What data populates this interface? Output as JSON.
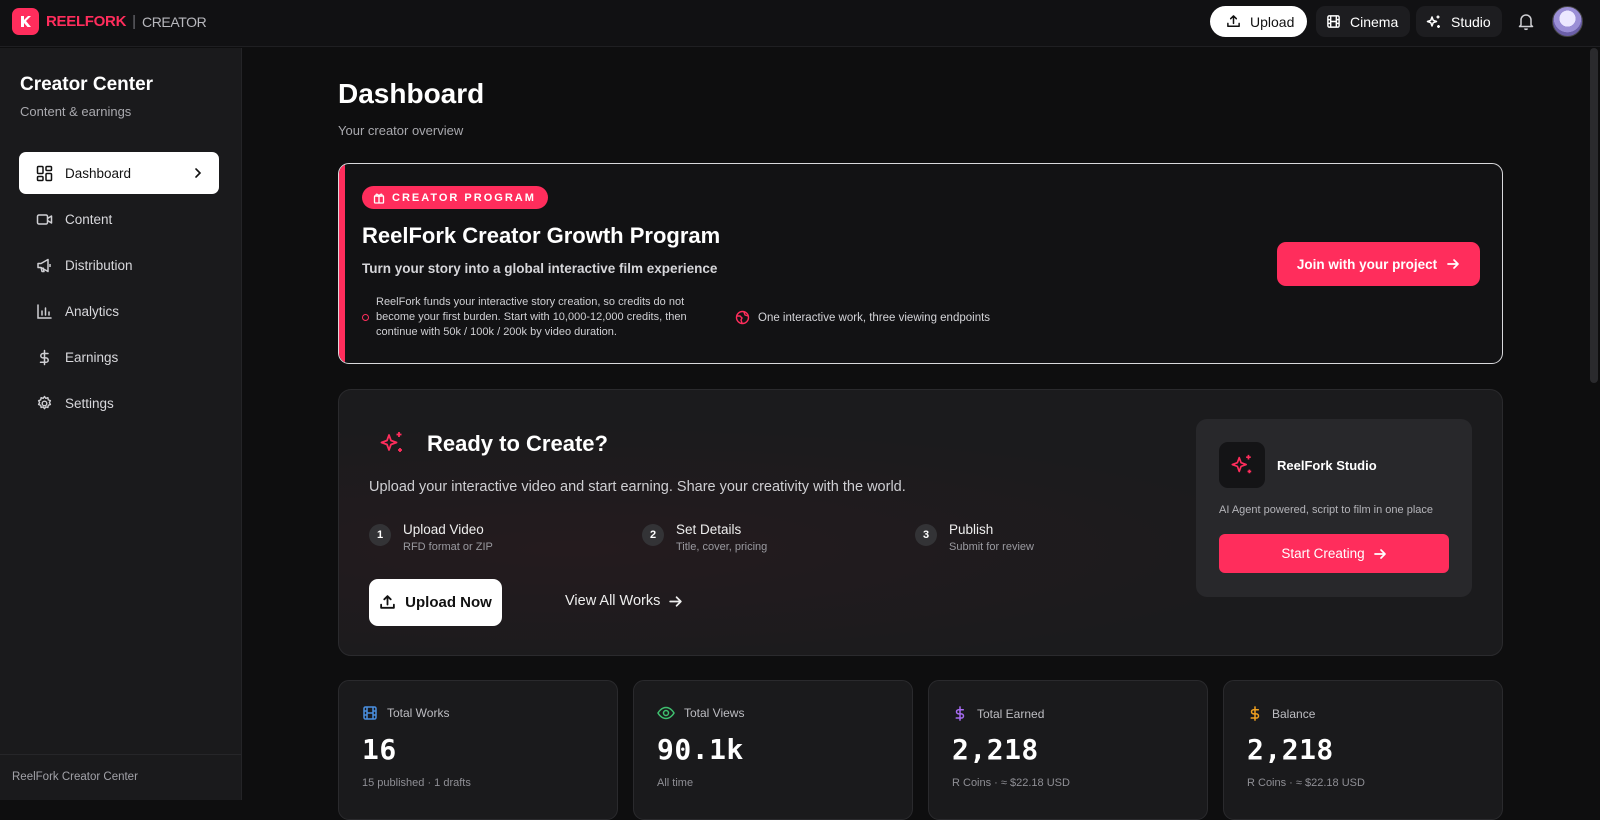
{
  "brand": {
    "name": "REELFORK",
    "separator": "|",
    "section": "CREATOR",
    "accent": "#ff2d5c"
  },
  "topnav": {
    "upload": "Upload",
    "cinema": "Cinema",
    "studio": "Studio"
  },
  "sidebar": {
    "title": "Creator Center",
    "subtitle": "Content & earnings",
    "items": [
      {
        "label": "Dashboard",
        "icon": "dashboard-icon",
        "active": true
      },
      {
        "label": "Content",
        "icon": "video-camera-icon"
      },
      {
        "label": "Distribution",
        "icon": "megaphone-icon"
      },
      {
        "label": "Analytics",
        "icon": "bar-chart-icon"
      },
      {
        "label": "Earnings",
        "icon": "dollar-icon"
      },
      {
        "label": "Settings",
        "icon": "gear-icon"
      }
    ],
    "footer": "ReelFork Creator Center"
  },
  "page": {
    "title": "Dashboard",
    "subtitle": "Your creator overview"
  },
  "promo": {
    "badge": "CREATOR PROGRAM",
    "title": "ReelFork Creator Growth Program",
    "subtitle": "Turn your story into a global interactive film experience",
    "bullet1": "ReelFork funds your interactive story creation, so credits do not become your first burden. Start with 10,000-12,000 credits, then continue with 50k / 100k / 200k by video duration.",
    "bullet2": "One interactive work, three viewing endpoints",
    "cta": "Join with your project"
  },
  "ready": {
    "title": "Ready to Create?",
    "description": "Upload your interactive video and start earning. Share your creativity with the world.",
    "steps": [
      {
        "num": "1",
        "title": "Upload Video",
        "sub": "RFD format or ZIP"
      },
      {
        "num": "2",
        "title": "Set Details",
        "sub": "Title, cover, pricing"
      },
      {
        "num": "3",
        "title": "Publish",
        "sub": "Submit for review"
      }
    ],
    "upload_now": "Upload Now",
    "view_all": "View All Works",
    "studio": {
      "name": "ReelFork Studio",
      "description": "AI Agent powered, script to film in one place",
      "cta": "Start Creating"
    }
  },
  "stats": [
    {
      "label": "Total Works",
      "value": "16",
      "sub": "15 published · 1 drafts",
      "icon": "film-icon",
      "color": "#4a8fe0"
    },
    {
      "label": "Total Views",
      "value": "90.1k",
      "sub": "All time",
      "icon": "eye-icon",
      "color": "#3fbf6f"
    },
    {
      "label": "Total Earned",
      "value": "2,218",
      "sub": "R Coins · ≈ $22.18 USD",
      "icon": "dollar-icon",
      "color": "#a66cf0"
    },
    {
      "label": "Balance",
      "value": "2,218",
      "sub": "R Coins · ≈ $22.18 USD",
      "icon": "dollar-icon",
      "color": "#f0a020"
    }
  ]
}
